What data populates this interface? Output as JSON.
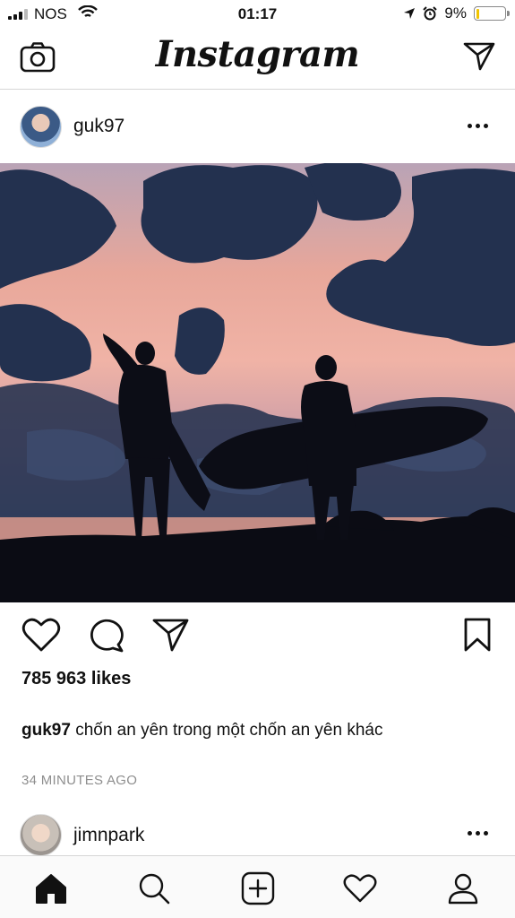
{
  "status_bar": {
    "carrier": "NOS",
    "time": "01:17",
    "battery_percent": "9%",
    "battery_level": 0.09,
    "icons": [
      "signal-icon",
      "wifi-icon",
      "location-arrow-icon",
      "alarm-icon",
      "battery-icon"
    ]
  },
  "top_nav": {
    "logo": "Instagram",
    "left_icon": "camera-icon",
    "right_icon": "direct-message-icon"
  },
  "post": {
    "username": "guk97",
    "likes": "785 963 likes",
    "caption_user": "guk97",
    "caption_text": " chốn an yên trong một chốn an yên khác",
    "time_ago": "34 MINUTES AGO",
    "action_icons": [
      "heart-icon",
      "comment-icon",
      "share-icon",
      "bookmark-icon"
    ]
  },
  "next_post": {
    "username": "jimnpark"
  },
  "tab_bar": {
    "tabs": [
      "home-icon",
      "search-icon",
      "add-post-icon",
      "activity-icon",
      "profile-icon"
    ]
  },
  "colors": {
    "divider": "#d6d6d6",
    "muted_text": "#8e8e8e",
    "battery_low": "#f2c500"
  }
}
